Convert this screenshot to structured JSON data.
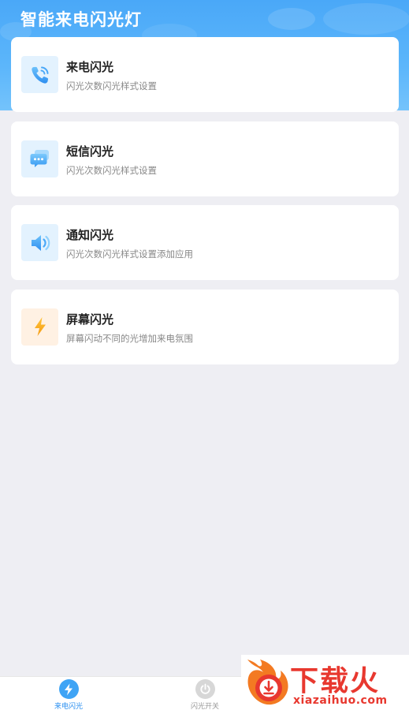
{
  "header": {
    "title": "智能来电闪光灯"
  },
  "features": [
    {
      "title": "来电闪光",
      "desc": "闪光次数闪光样式设置",
      "icon": "phone-ringing-icon"
    },
    {
      "title": "短信闪光",
      "desc": "闪光次数闪光样式设置",
      "icon": "chat-bubble-icon"
    },
    {
      "title": "通知闪光",
      "desc": "闪光次数闪光样式设置添加应用",
      "icon": "speaker-icon"
    },
    {
      "title": "屏幕闪光",
      "desc": "屏幕闪动不同的光增加来电氛围",
      "icon": "lightning-icon"
    }
  ],
  "tabbar": {
    "tabs": [
      {
        "label": "来电闪光",
        "icon": "lightning-icon",
        "active": true
      },
      {
        "label": "闪光开关",
        "icon": "power-icon",
        "active": false
      }
    ]
  },
  "watermark": {
    "brand": "下载火",
    "url": "xiazaihuo.com"
  },
  "colors": {
    "accent": "#3fa4f5",
    "header": "#4aa8f8",
    "lightning": "#f7a11a",
    "watermark": "#e8382f",
    "background": "#eeeef3"
  }
}
